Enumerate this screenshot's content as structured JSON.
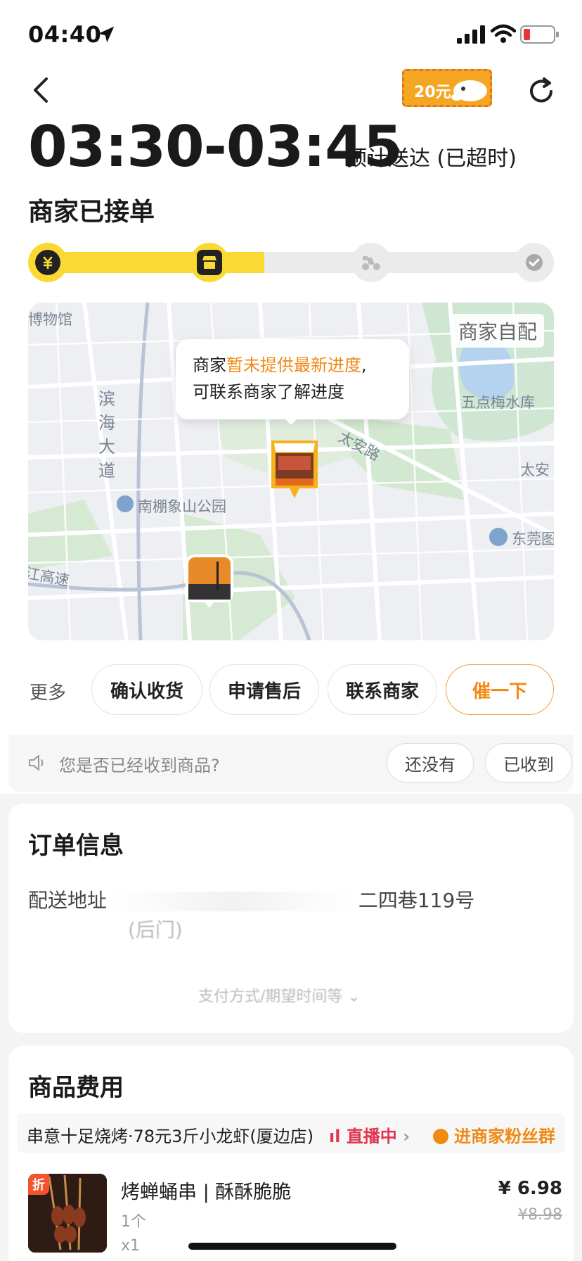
{
  "status_bar": {
    "time": "04:40"
  },
  "header": {
    "coupon_label": "20元"
  },
  "delivery": {
    "eta_range": "03:30-03:45",
    "eta_note": "预计送达 (已超时)",
    "status_title": "商家已接单",
    "progress": {
      "completed_steps": 2,
      "total_steps": 4
    },
    "steps": [
      "payment-icon",
      "store-icon",
      "rider-icon",
      "check-icon"
    ]
  },
  "map": {
    "tag": "商家自配",
    "bubble": {
      "prefix": "商家",
      "highlight": "暂未提供最新进度",
      "suffix": ",",
      "line2": "可联系商家了解进度"
    },
    "labels": {
      "museum": "博物馆",
      "road_vertical": "滨海大道",
      "taian_road": "太安路",
      "park": "南棚象山公园",
      "reservoir": "五点梅水库",
      "highway": "江高速",
      "dongguan": "东莞图",
      "tai": "太安"
    }
  },
  "actions": {
    "more": "更多",
    "confirm": "确认收货",
    "after_sale": "申请售后",
    "contact": "联系商家",
    "urge": "催一下"
  },
  "receipt_prompt": {
    "question": "您是否已经收到商品?",
    "not_yet": "还没有",
    "received": "已收到"
  },
  "order_info": {
    "title": "订单信息",
    "address_label": "配送地址",
    "address_visible": "二四巷119号",
    "address_line2": "(后门)",
    "expand_hint": "支付方式/期望时间等"
  },
  "fees": {
    "title": "商品费用",
    "shop_name": "串意十足烧烤·78元3斤小龙虾(厦边店)",
    "live_label": "直播中",
    "fans_label": "进商家粉丝群",
    "product": {
      "discount_tag": "折",
      "name": "烤蝉蛹串 | 酥酥脆脆",
      "spec": "1个",
      "qty": "x1",
      "price": "¥ 6.98",
      "original_price": "¥8.98"
    }
  },
  "colors": {
    "accent_yellow": "#fbd934",
    "accent_orange": "#f08a15",
    "live_red": "#e0364f"
  }
}
